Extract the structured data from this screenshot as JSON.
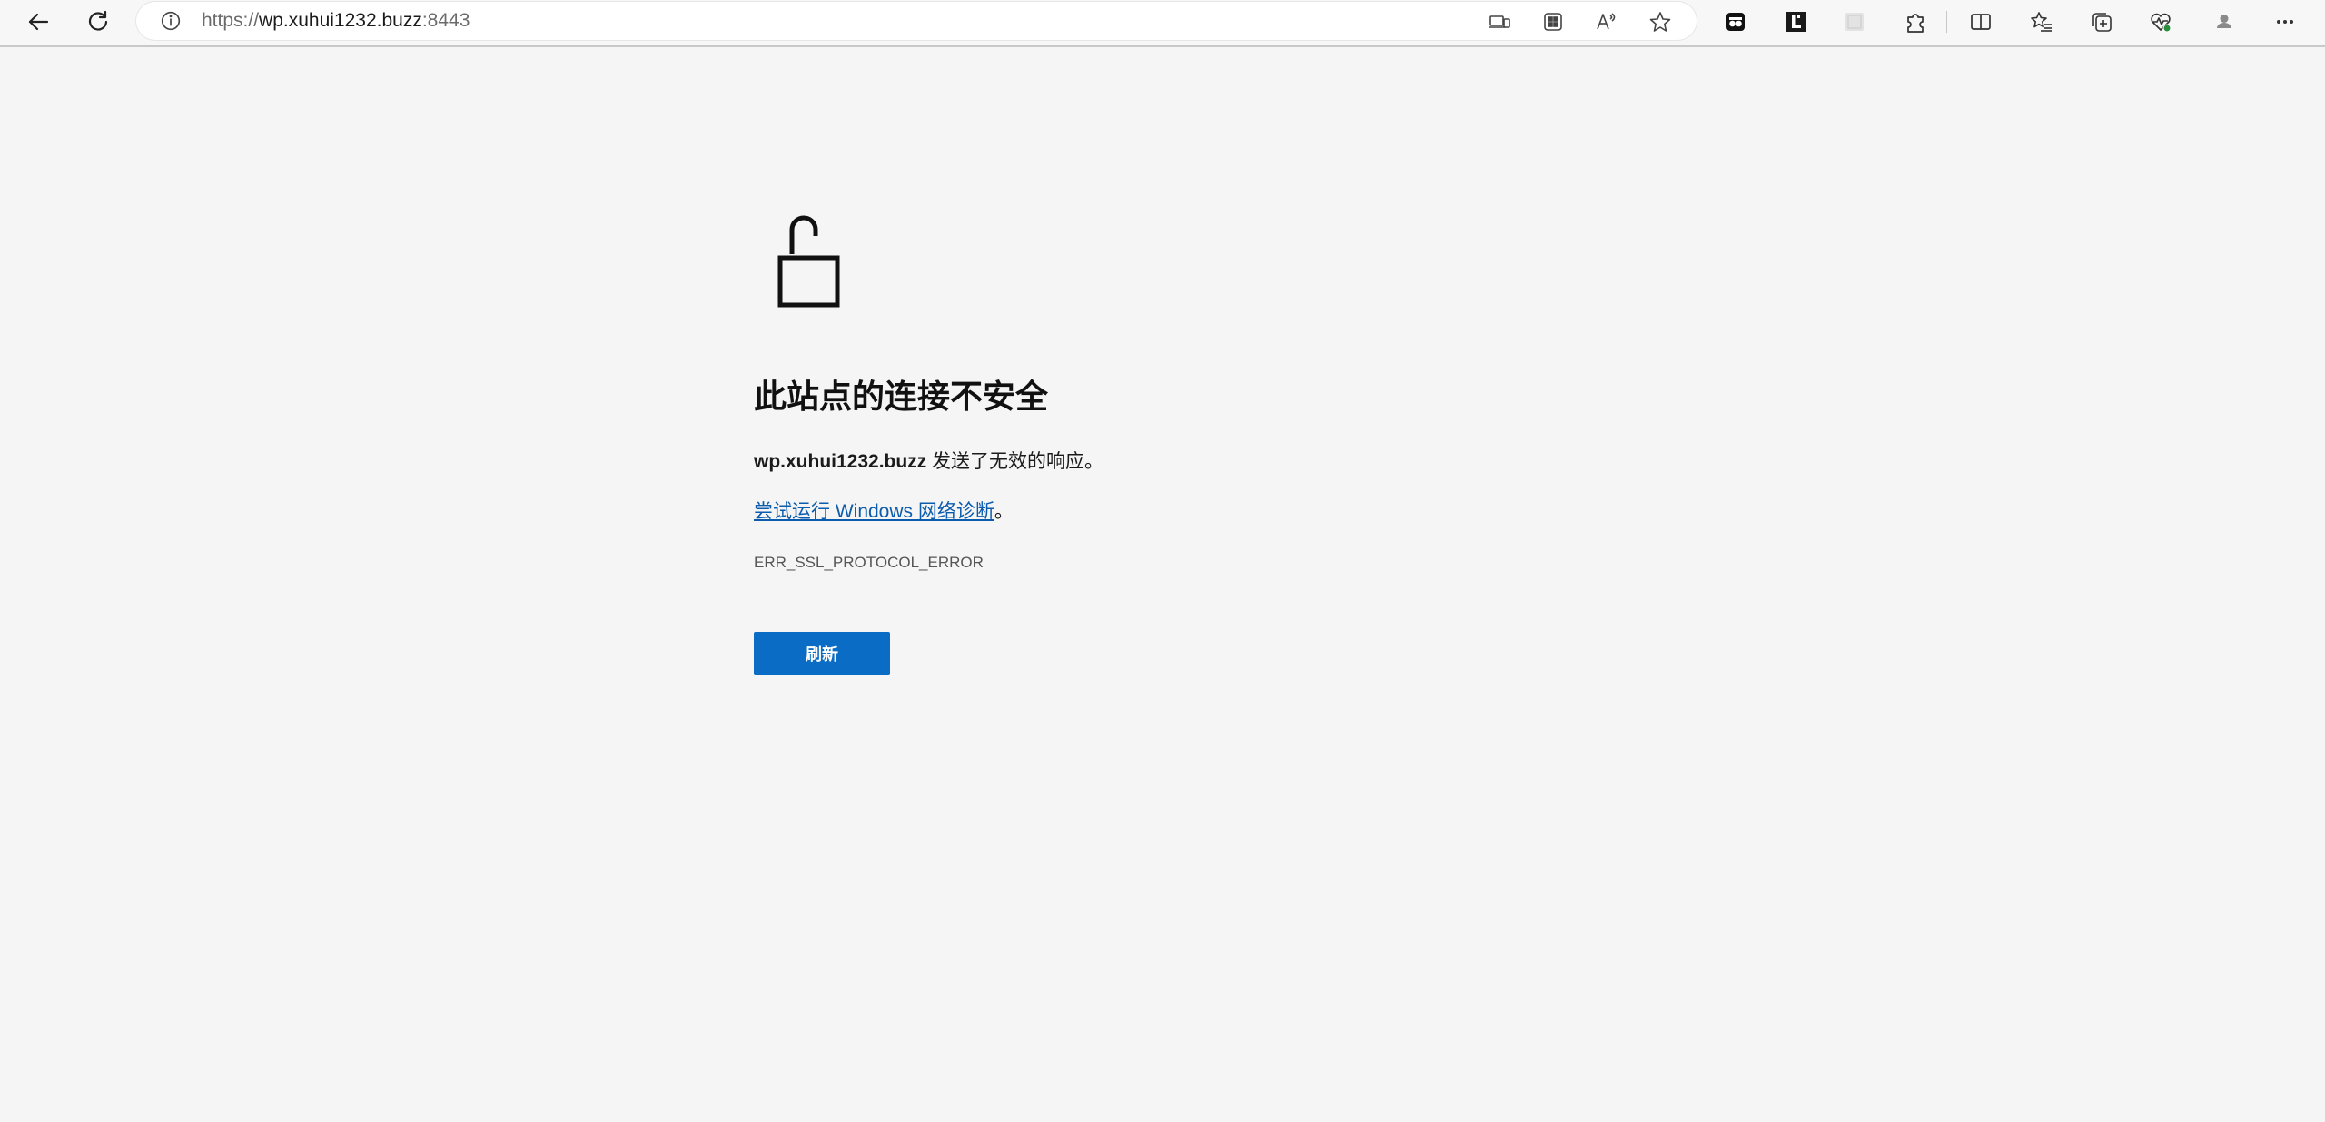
{
  "browser": {
    "address": {
      "scheme": "https://",
      "host": "wp.xuhui1232.buzz",
      "port": ":8443"
    },
    "icons": {
      "back": "back-arrow-icon",
      "refresh": "refresh-icon",
      "site_info": "info-icon",
      "app_available": "app-available-icon",
      "apps": "apps-icon",
      "read_aloud": "read-aloud-icon",
      "favorite": "star-icon",
      "extensions": [
        "extension-icon",
        "letter-l-extension-icon",
        "blank-extension-icon"
      ],
      "extensions_menu": "puzzle-icon",
      "split_screen": "split-screen-icon",
      "favorites": "favorites-list-icon",
      "collections": "collections-icon",
      "browser_essentials": "heart-pulse-icon",
      "profile": "profile-icon",
      "more": "more-dots-icon"
    }
  },
  "error_page": {
    "title": "此站点的连接不安全",
    "domain": "wp.xuhui1232.buzz",
    "description": " 发送了无效的响应。",
    "suggestion_link": "尝试运行 Windows 网络诊断",
    "suggestion_suffix": "。",
    "error_code": "ERR_SSL_PROTOCOL_ERROR",
    "refresh_button": "刷新"
  },
  "colors": {
    "page_background": "#f5f5f5",
    "button_background": "#0a6cc4",
    "link": "#0b5cad"
  }
}
